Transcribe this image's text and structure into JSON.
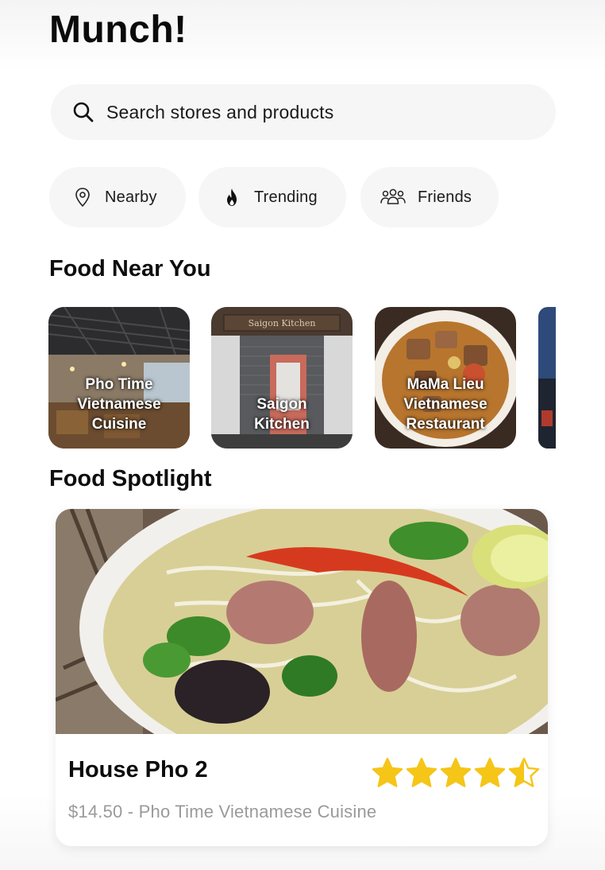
{
  "app": {
    "title": "Munch!"
  },
  "search": {
    "placeholder": "Search stores and products"
  },
  "filters": [
    {
      "label": "Nearby",
      "icon": "location-pin-icon"
    },
    {
      "label": "Trending",
      "icon": "flame-icon"
    },
    {
      "label": "Friends",
      "icon": "group-icon"
    }
  ],
  "sections": {
    "near": "Food Near You",
    "spotlight": "Food Spotlight"
  },
  "restaurants": [
    {
      "name": "Pho Time\nVietnamese\nCuisine"
    },
    {
      "name": "Saigon\nKitchen",
      "sign": "Saigon Kitchen"
    },
    {
      "name": "MaMa Lieu\nVietnamese\nRestaurant"
    }
  ],
  "spotlight": {
    "dish": "House Pho 2",
    "subtitle": "$14.50 - Pho Time Vietnamese Cuisine",
    "rating": 4.5,
    "rating_max": 5
  },
  "colors": {
    "star": "#f5c518",
    "chip_bg": "#f6f6f7",
    "subtitle": "#9a9a9a"
  }
}
